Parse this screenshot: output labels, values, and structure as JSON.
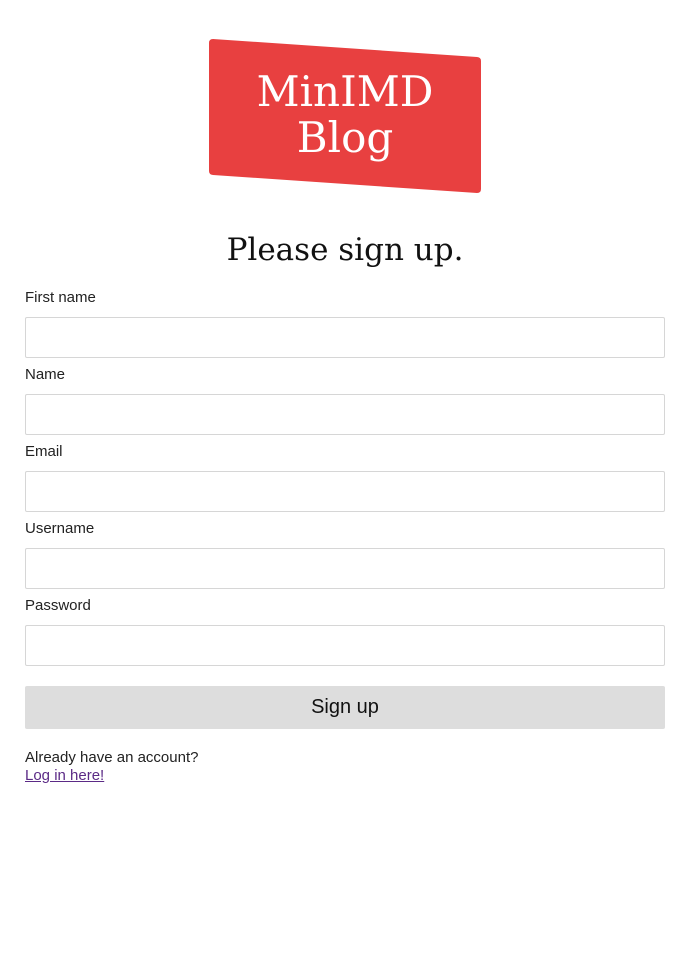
{
  "logo": {
    "line1": "MinIMD",
    "line2": "Blog",
    "color": "#e84040"
  },
  "page_title": "Please sign up.",
  "form": {
    "fields": [
      {
        "label": "First name",
        "value": "",
        "placeholder": ""
      },
      {
        "label": "Name",
        "value": "",
        "placeholder": ""
      },
      {
        "label": "Email",
        "value": "",
        "placeholder": ""
      },
      {
        "label": "Username",
        "value": "",
        "placeholder": ""
      },
      {
        "label": "Password",
        "value": "",
        "placeholder": ""
      }
    ],
    "submit_label": "Sign up"
  },
  "account": {
    "prompt": "Already have an account?",
    "link_label": "Log in here!"
  },
  "colors": {
    "link_visited": "#5b2a86",
    "button_bg": "#dddddd"
  }
}
